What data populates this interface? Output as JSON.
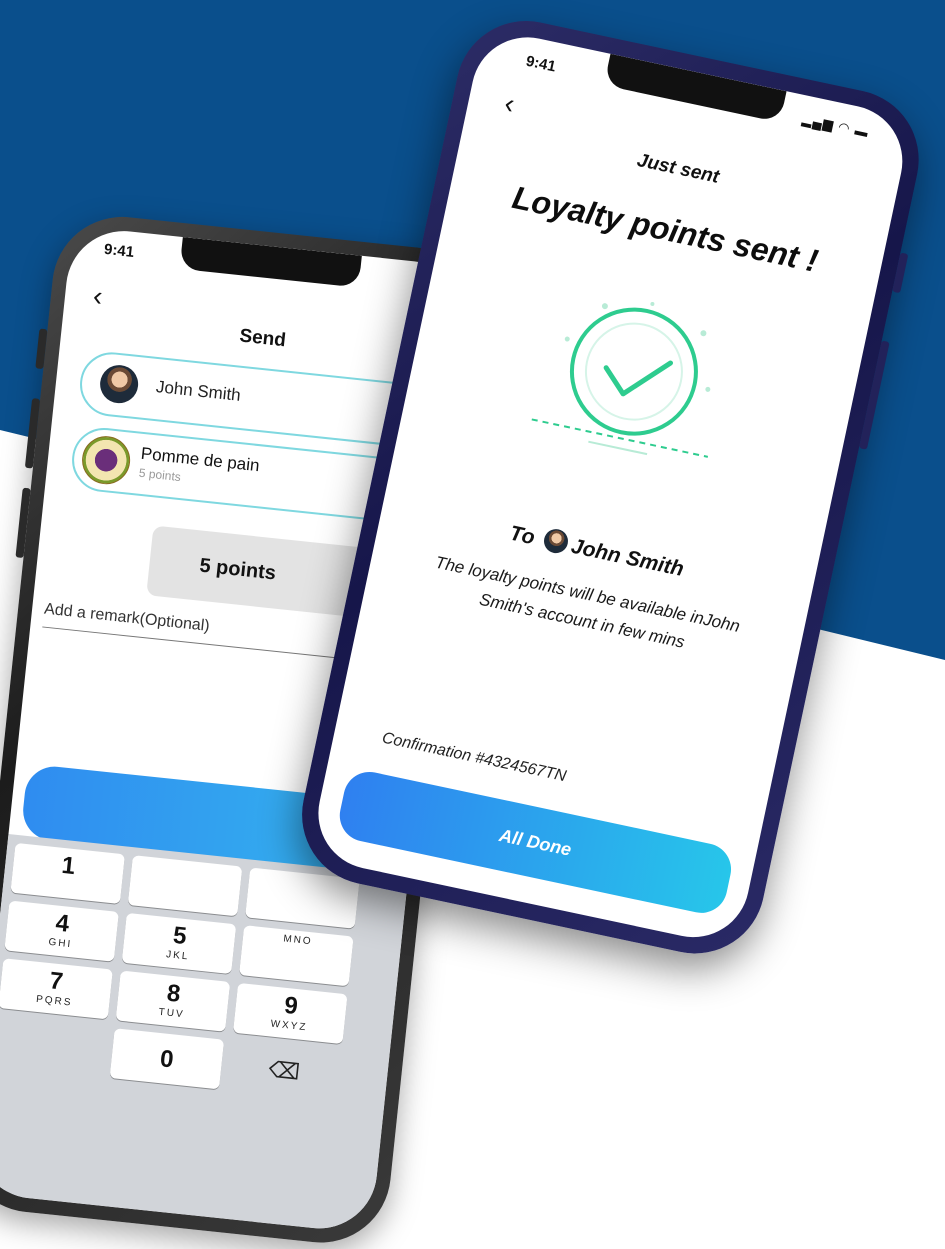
{
  "colors": {
    "background_blue": "#0a4f8c",
    "accent_gradient_start": "#2f80f0",
    "accent_gradient_end": "#27c6ea",
    "success_green": "#2ecc8f"
  },
  "back_phone": {
    "time": "9:41",
    "title": "Send",
    "recipient": {
      "name": "John Smith"
    },
    "merchant": {
      "name": "Pomme de pain",
      "points": "5 points"
    },
    "points_value": "5 points",
    "remark_placeholder": "Add a remark(Optional)",
    "keypad": [
      {
        "num": "1",
        "letters": ""
      },
      {
        "num": "4",
        "letters": "GHI"
      },
      {
        "num": "5",
        "letters": "JKL"
      },
      {
        "num": "",
        "letters": "MNO"
      },
      {
        "num": "7",
        "letters": "PQRS"
      },
      {
        "num": "8",
        "letters": "TUV"
      },
      {
        "num": "9",
        "letters": "WXYZ"
      },
      {
        "num": "0",
        "letters": ""
      }
    ]
  },
  "front_phone": {
    "time": "9:41",
    "title": "Just sent",
    "headline": "Loyalty points sent !",
    "to_label": "To",
    "recipient_name": "John Smith",
    "description": "The loyalty points will be available inJohn Smith's account in few mins",
    "confirmation": "Confirmation #4324567TN",
    "done_button": "All Done"
  }
}
